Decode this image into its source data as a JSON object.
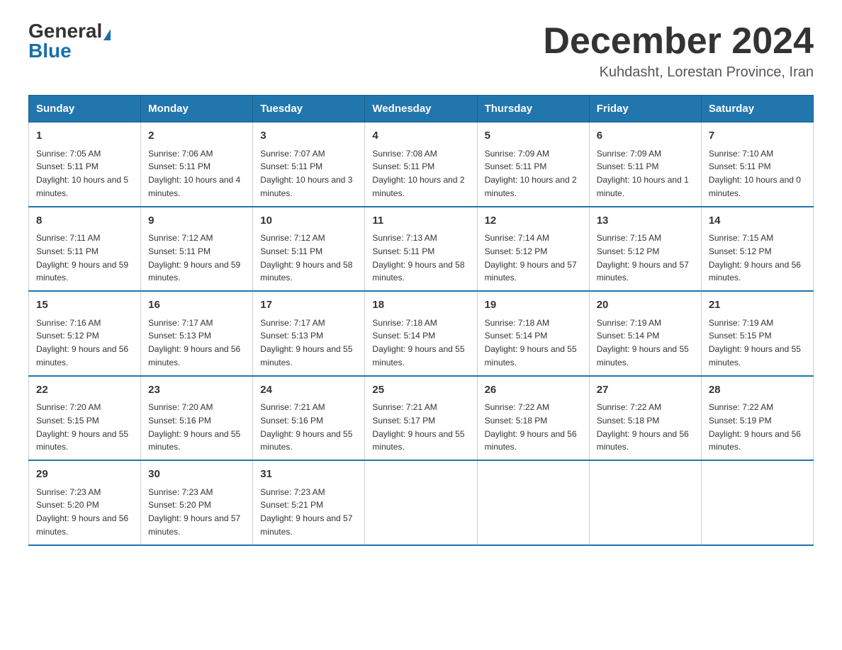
{
  "logo": {
    "general": "General",
    "blue": "Blue",
    "triangle": "▲"
  },
  "title": "December 2024",
  "location": "Kuhdasht, Lorestan Province, Iran",
  "days_of_week": [
    "Sunday",
    "Monday",
    "Tuesday",
    "Wednesday",
    "Thursday",
    "Friday",
    "Saturday"
  ],
  "weeks": [
    [
      {
        "day": "1",
        "sunrise": "Sunrise: 7:05 AM",
        "sunset": "Sunset: 5:11 PM",
        "daylight": "Daylight: 10 hours and 5 minutes."
      },
      {
        "day": "2",
        "sunrise": "Sunrise: 7:06 AM",
        "sunset": "Sunset: 5:11 PM",
        "daylight": "Daylight: 10 hours and 4 minutes."
      },
      {
        "day": "3",
        "sunrise": "Sunrise: 7:07 AM",
        "sunset": "Sunset: 5:11 PM",
        "daylight": "Daylight: 10 hours and 3 minutes."
      },
      {
        "day": "4",
        "sunrise": "Sunrise: 7:08 AM",
        "sunset": "Sunset: 5:11 PM",
        "daylight": "Daylight: 10 hours and 2 minutes."
      },
      {
        "day": "5",
        "sunrise": "Sunrise: 7:09 AM",
        "sunset": "Sunset: 5:11 PM",
        "daylight": "Daylight: 10 hours and 2 minutes."
      },
      {
        "day": "6",
        "sunrise": "Sunrise: 7:09 AM",
        "sunset": "Sunset: 5:11 PM",
        "daylight": "Daylight: 10 hours and 1 minute."
      },
      {
        "day": "7",
        "sunrise": "Sunrise: 7:10 AM",
        "sunset": "Sunset: 5:11 PM",
        "daylight": "Daylight: 10 hours and 0 minutes."
      }
    ],
    [
      {
        "day": "8",
        "sunrise": "Sunrise: 7:11 AM",
        "sunset": "Sunset: 5:11 PM",
        "daylight": "Daylight: 9 hours and 59 minutes."
      },
      {
        "day": "9",
        "sunrise": "Sunrise: 7:12 AM",
        "sunset": "Sunset: 5:11 PM",
        "daylight": "Daylight: 9 hours and 59 minutes."
      },
      {
        "day": "10",
        "sunrise": "Sunrise: 7:12 AM",
        "sunset": "Sunset: 5:11 PM",
        "daylight": "Daylight: 9 hours and 58 minutes."
      },
      {
        "day": "11",
        "sunrise": "Sunrise: 7:13 AM",
        "sunset": "Sunset: 5:11 PM",
        "daylight": "Daylight: 9 hours and 58 minutes."
      },
      {
        "day": "12",
        "sunrise": "Sunrise: 7:14 AM",
        "sunset": "Sunset: 5:12 PM",
        "daylight": "Daylight: 9 hours and 57 minutes."
      },
      {
        "day": "13",
        "sunrise": "Sunrise: 7:15 AM",
        "sunset": "Sunset: 5:12 PM",
        "daylight": "Daylight: 9 hours and 57 minutes."
      },
      {
        "day": "14",
        "sunrise": "Sunrise: 7:15 AM",
        "sunset": "Sunset: 5:12 PM",
        "daylight": "Daylight: 9 hours and 56 minutes."
      }
    ],
    [
      {
        "day": "15",
        "sunrise": "Sunrise: 7:16 AM",
        "sunset": "Sunset: 5:12 PM",
        "daylight": "Daylight: 9 hours and 56 minutes."
      },
      {
        "day": "16",
        "sunrise": "Sunrise: 7:17 AM",
        "sunset": "Sunset: 5:13 PM",
        "daylight": "Daylight: 9 hours and 56 minutes."
      },
      {
        "day": "17",
        "sunrise": "Sunrise: 7:17 AM",
        "sunset": "Sunset: 5:13 PM",
        "daylight": "Daylight: 9 hours and 55 minutes."
      },
      {
        "day": "18",
        "sunrise": "Sunrise: 7:18 AM",
        "sunset": "Sunset: 5:14 PM",
        "daylight": "Daylight: 9 hours and 55 minutes."
      },
      {
        "day": "19",
        "sunrise": "Sunrise: 7:18 AM",
        "sunset": "Sunset: 5:14 PM",
        "daylight": "Daylight: 9 hours and 55 minutes."
      },
      {
        "day": "20",
        "sunrise": "Sunrise: 7:19 AM",
        "sunset": "Sunset: 5:14 PM",
        "daylight": "Daylight: 9 hours and 55 minutes."
      },
      {
        "day": "21",
        "sunrise": "Sunrise: 7:19 AM",
        "sunset": "Sunset: 5:15 PM",
        "daylight": "Daylight: 9 hours and 55 minutes."
      }
    ],
    [
      {
        "day": "22",
        "sunrise": "Sunrise: 7:20 AM",
        "sunset": "Sunset: 5:15 PM",
        "daylight": "Daylight: 9 hours and 55 minutes."
      },
      {
        "day": "23",
        "sunrise": "Sunrise: 7:20 AM",
        "sunset": "Sunset: 5:16 PM",
        "daylight": "Daylight: 9 hours and 55 minutes."
      },
      {
        "day": "24",
        "sunrise": "Sunrise: 7:21 AM",
        "sunset": "Sunset: 5:16 PM",
        "daylight": "Daylight: 9 hours and 55 minutes."
      },
      {
        "day": "25",
        "sunrise": "Sunrise: 7:21 AM",
        "sunset": "Sunset: 5:17 PM",
        "daylight": "Daylight: 9 hours and 55 minutes."
      },
      {
        "day": "26",
        "sunrise": "Sunrise: 7:22 AM",
        "sunset": "Sunset: 5:18 PM",
        "daylight": "Daylight: 9 hours and 56 minutes."
      },
      {
        "day": "27",
        "sunrise": "Sunrise: 7:22 AM",
        "sunset": "Sunset: 5:18 PM",
        "daylight": "Daylight: 9 hours and 56 minutes."
      },
      {
        "day": "28",
        "sunrise": "Sunrise: 7:22 AM",
        "sunset": "Sunset: 5:19 PM",
        "daylight": "Daylight: 9 hours and 56 minutes."
      }
    ],
    [
      {
        "day": "29",
        "sunrise": "Sunrise: 7:23 AM",
        "sunset": "Sunset: 5:20 PM",
        "daylight": "Daylight: 9 hours and 56 minutes."
      },
      {
        "day": "30",
        "sunrise": "Sunrise: 7:23 AM",
        "sunset": "Sunset: 5:20 PM",
        "daylight": "Daylight: 9 hours and 57 minutes."
      },
      {
        "day": "31",
        "sunrise": "Sunrise: 7:23 AM",
        "sunset": "Sunset: 5:21 PM",
        "daylight": "Daylight: 9 hours and 57 minutes."
      },
      null,
      null,
      null,
      null
    ]
  ]
}
